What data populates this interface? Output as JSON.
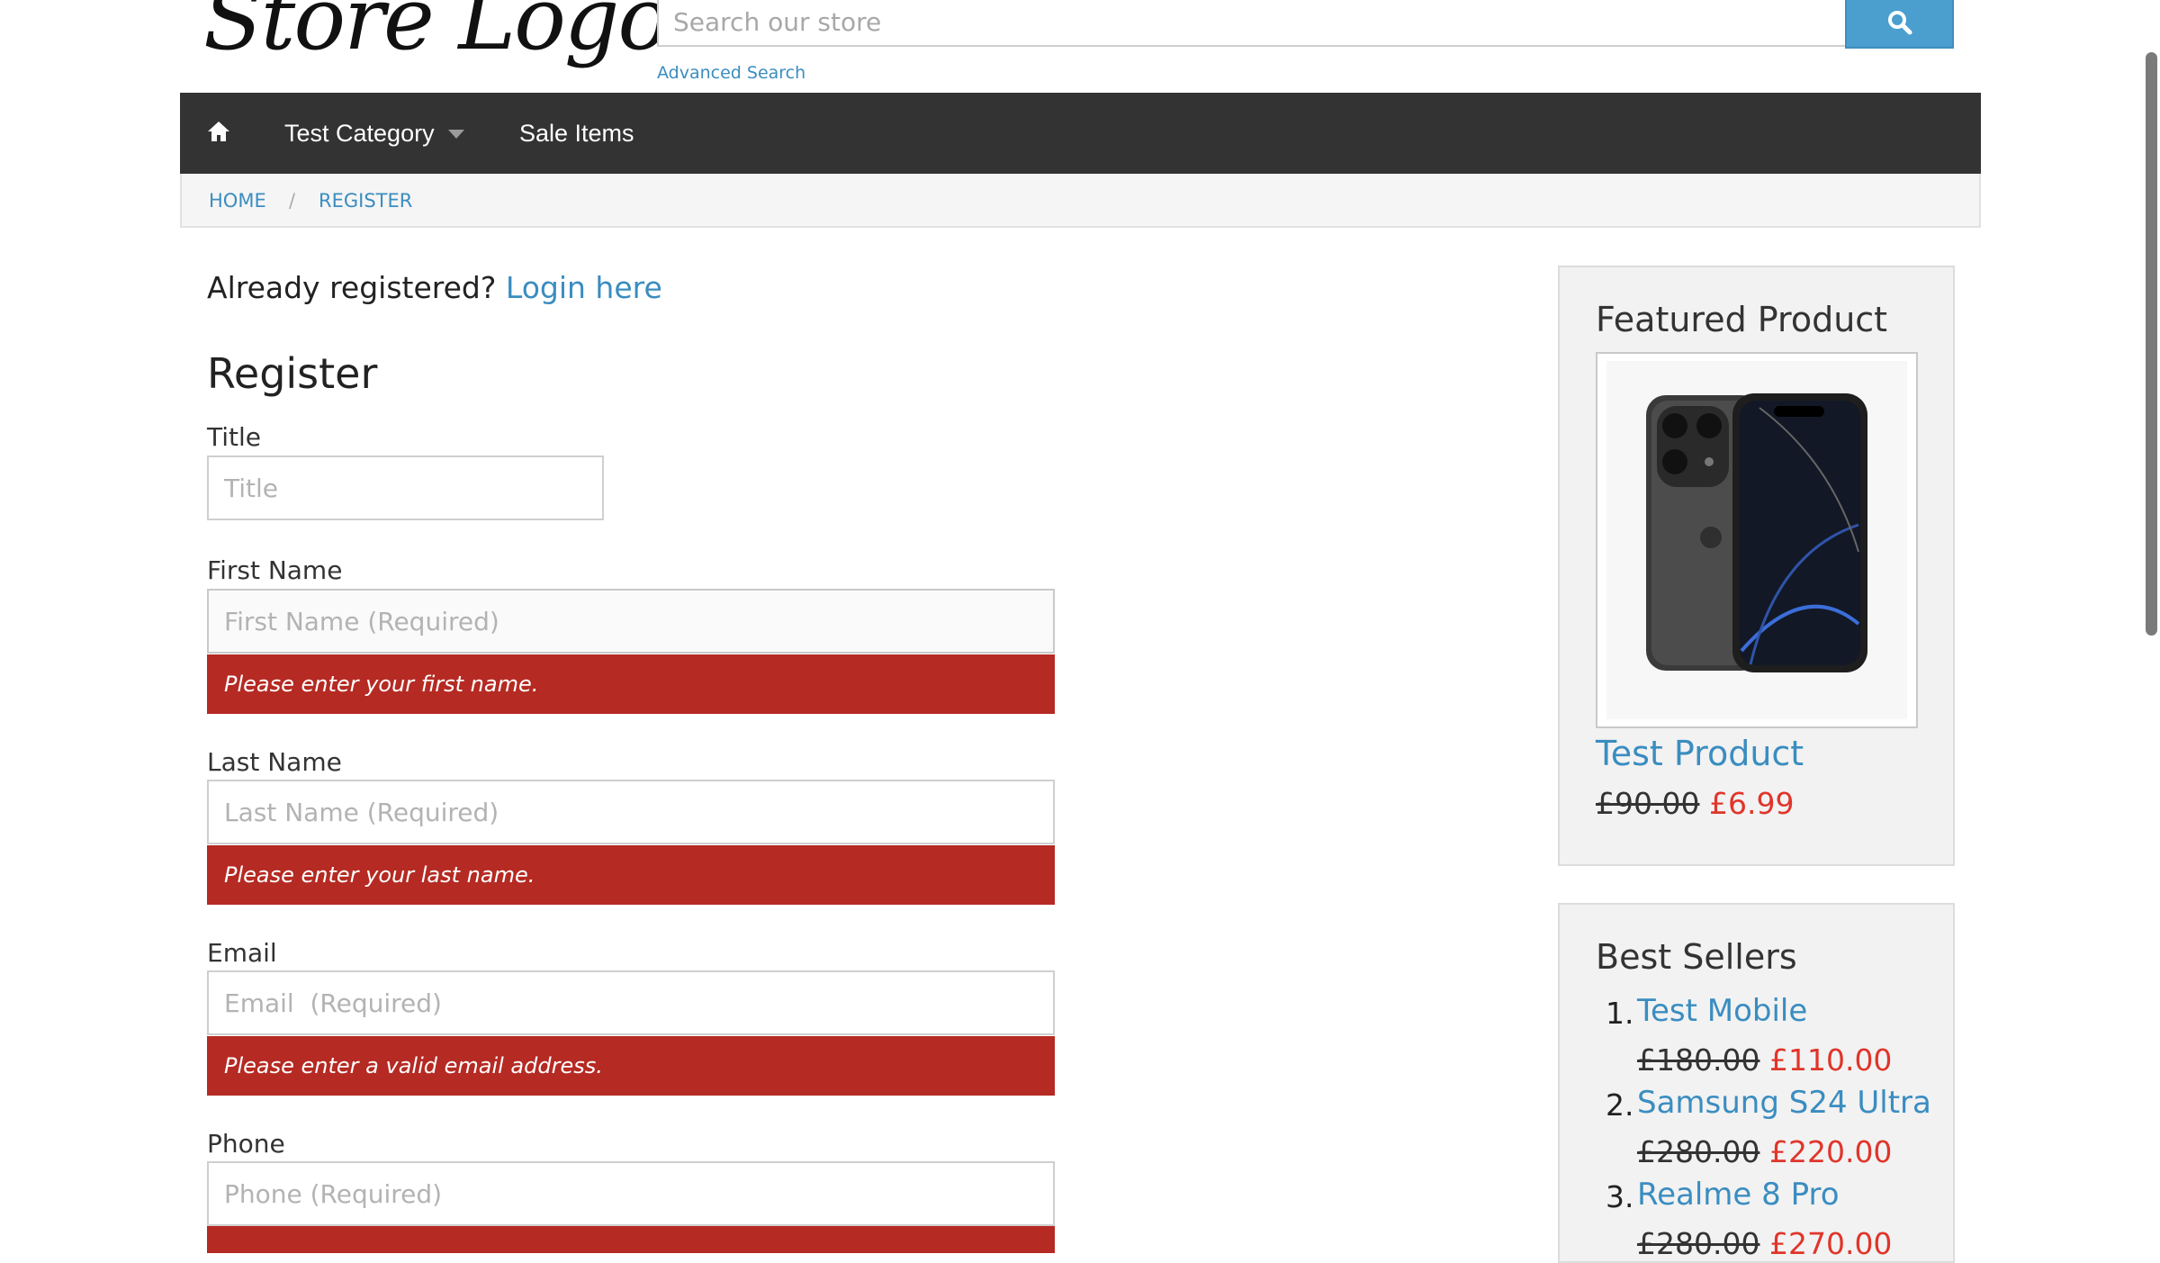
{
  "header": {
    "logo_text": "Store Logo",
    "search": {
      "placeholder": "Search our store"
    },
    "advanced_search_label": "Advanced Search",
    "colors": {
      "accent": "#4a9fcf",
      "nav_bg": "#333333",
      "error_bg": "#b52a23",
      "sale_price": "#e0352b"
    }
  },
  "nav": {
    "home_icon": "home-icon",
    "items": [
      {
        "label": "Test Category",
        "has_dropdown": true
      },
      {
        "label": "Sale Items",
        "has_dropdown": false
      }
    ]
  },
  "breadcrumb": {
    "items": [
      "HOME",
      "REGISTER"
    ],
    "separator": "/"
  },
  "main": {
    "already_registered_text": "Already registered?",
    "login_link": "Login here",
    "heading": "Register",
    "fields": [
      {
        "label": "Title",
        "placeholder": "Title",
        "value": "",
        "error": ""
      },
      {
        "label": "First Name",
        "placeholder": "First Name (Required)",
        "value": "",
        "error": "Please enter your first name."
      },
      {
        "label": "Last Name",
        "placeholder": "Last Name (Required)",
        "value": "",
        "error": "Please enter your last name."
      },
      {
        "label": "Email",
        "placeholder": "Email  (Required)",
        "value": "",
        "error": "Please enter a valid email address."
      },
      {
        "label": "Phone",
        "placeholder": "Phone (Required)",
        "value": "",
        "error": ""
      }
    ]
  },
  "sidebar": {
    "featured": {
      "title": "Featured Product",
      "product_name": "Test Product",
      "old_price": "£90.00",
      "new_price": "£6.99"
    },
    "best_sellers": {
      "title": "Best Sellers",
      "items": [
        {
          "rank": "1.",
          "name": "Test Mobile",
          "old_price": "£180.00",
          "new_price": "£110.00"
        },
        {
          "rank": "2.",
          "name": "Samsung S24 Ultra",
          "old_price": "£280.00",
          "new_price": "£220.00"
        },
        {
          "rank": "3.",
          "name": "Realme 8 Pro",
          "old_price": "£280.00",
          "new_price": "£270.00"
        }
      ]
    }
  }
}
